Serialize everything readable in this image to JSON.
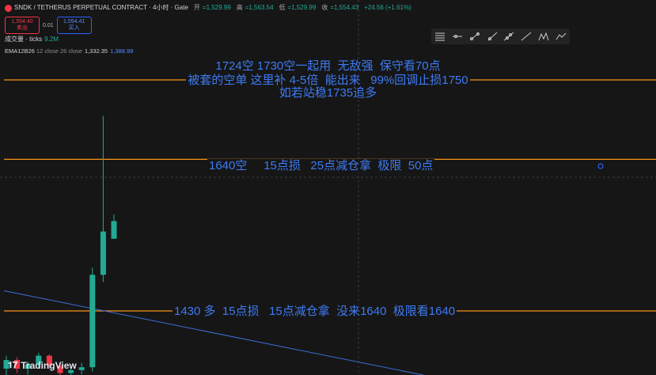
{
  "header": {
    "symbol": "SNDK / TETHERUS PERPETUAL CONTRACT · 4小时 · Gate",
    "open_label": "开",
    "open": "=1,529.99",
    "high_label": "高",
    "high": "=1,563.54",
    "low_label": "低",
    "low": "=1,529.99",
    "close_label": "收",
    "close": "=1,554.43",
    "change": "+24.56 (+1.61%)"
  },
  "trade": {
    "sell_price": "1,554.40",
    "sell_label": "卖出",
    "spread": "0.01",
    "buy_price": "1,554.41",
    "buy_label": "买入"
  },
  "volume": {
    "label": "成交量 · ticks",
    "value": "9.2M"
  },
  "ema": {
    "label": "EMA12B26",
    "params": "12 close 26 close",
    "value1": "1,332.35",
    "value2": "1,388.99"
  },
  "toolbar": {
    "icons": [
      "menu-lines-icon",
      "horizontal-ray-icon",
      "trend-line-icon",
      "ray-icon",
      "extended-line-icon",
      "info-line-icon",
      "pattern-icon",
      "path-icon"
    ]
  },
  "annotations": {
    "note1": "1724空 1730空一起用  无敌强  保守看70点",
    "note2": "被套的空单 这里补 4-5倍  能出来   99%回调止损1750",
    "note3": "如若站稳1735追多",
    "line2": "1640空     15点损   25点减仓拿  极限  50点",
    "line3": "1430 多  15点损   15点减仓拿  没来1640  极限看1640"
  },
  "brand": {
    "name": "TradingView"
  },
  "colors": {
    "background": "#161616",
    "up": "#22ab94",
    "down": "#f23645",
    "note_text": "#3d7bf5",
    "level_line": "#f7931a",
    "trend_line": "#3a6fd8"
  },
  "chart_data": {
    "type": "candlestick",
    "candles": [
      {
        "o": 1350,
        "h": 1368,
        "l": 1340,
        "c": 1362
      },
      {
        "o": 1362,
        "h": 1366,
        "l": 1344,
        "c": 1350
      },
      {
        "o": 1350,
        "h": 1360,
        "l": 1342,
        "c": 1356
      },
      {
        "o": 1356,
        "h": 1372,
        "l": 1350,
        "c": 1368
      },
      {
        "o": 1368,
        "h": 1370,
        "l": 1350,
        "c": 1354
      },
      {
        "o": 1354,
        "h": 1358,
        "l": 1340,
        "c": 1344
      },
      {
        "o": 1344,
        "h": 1352,
        "l": 1336,
        "c": 1348
      },
      {
        "o": 1348,
        "h": 1358,
        "l": 1342,
        "c": 1352
      },
      {
        "o": 1352,
        "h": 1490,
        "l": 1346,
        "c": 1480
      },
      {
        "o": 1480,
        "h": 1700,
        "l": 1470,
        "c": 1540
      },
      {
        "o": 1529.99,
        "h": 1563.54,
        "l": 1529.99,
        "c": 1554.43
      }
    ],
    "horizontal_levels": [
      1750,
      1640,
      1430
    ],
    "trend_line": {
      "start": 1458,
      "end": 1340
    }
  }
}
